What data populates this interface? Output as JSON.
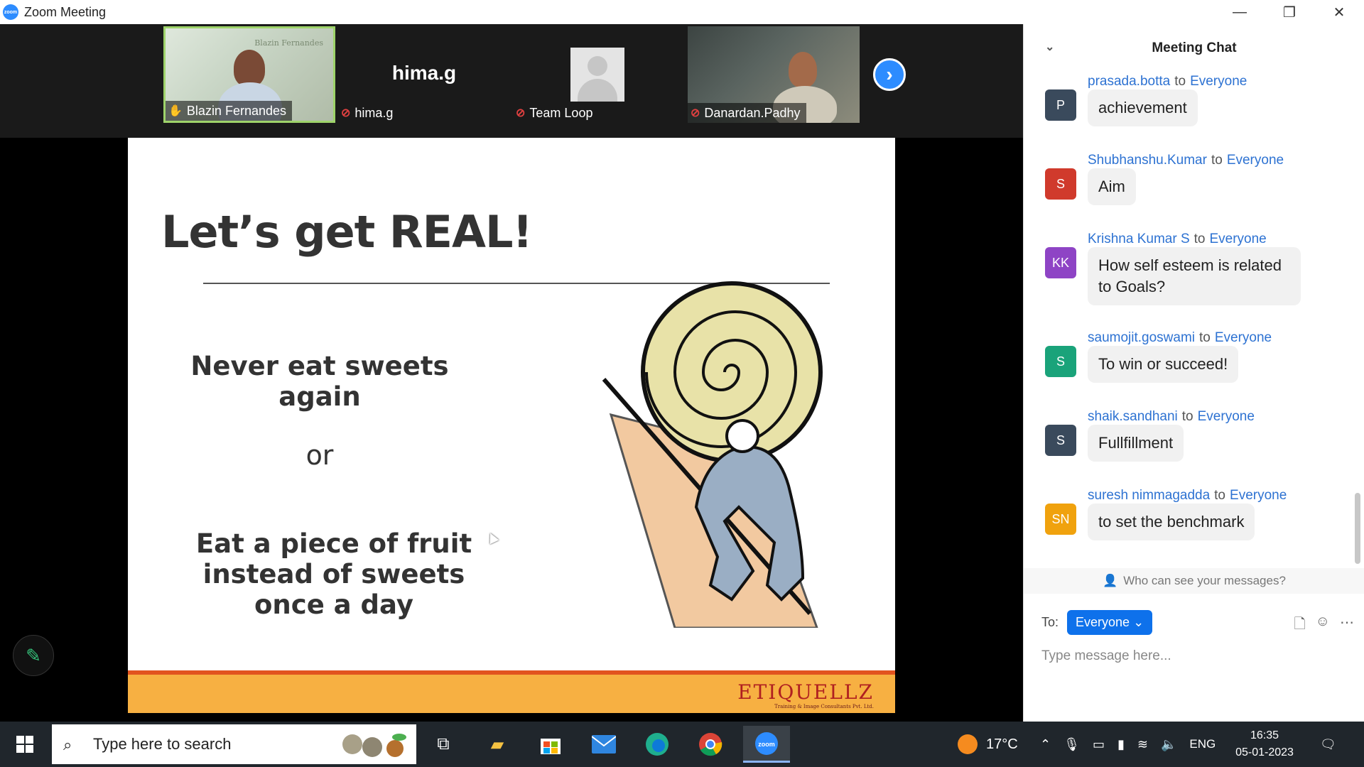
{
  "window": {
    "title": "Zoom Meeting",
    "logo_text": "zoom",
    "minimize": "—",
    "restore": "❐",
    "close": "✕"
  },
  "participants": [
    {
      "name": "Blazin Fernandes",
      "video": true,
      "active": true,
      "muted": false,
      "backdrop_text": "Blazin Fernandes"
    },
    {
      "name": "hima.g",
      "video": false,
      "active": false,
      "muted": true,
      "display_name": "hima.g"
    },
    {
      "name": "Team Loop",
      "video": false,
      "active": false,
      "muted": true
    },
    {
      "name": "Danardan.Padhy",
      "video": true,
      "active": false,
      "muted": true
    }
  ],
  "gallery": {
    "next_label": "›"
  },
  "slide": {
    "title": "Let’s get REAL!",
    "line1": "Never eat sweets again",
    "line2": "or",
    "line3": "Eat a piece of fruit instead of sweets once a day",
    "logo": "ETIQUELLZ",
    "logo_sub": "Training & Image Consultants Pvt. Ltd."
  },
  "annotate": {
    "icon": "pencil-icon",
    "glyph": "✎"
  },
  "chat": {
    "title": "Meeting Chat",
    "collapse": "⌄",
    "to_word": "to",
    "messages": [
      {
        "sender": "prasada.botta",
        "recipient": "Everyone",
        "initials": "P",
        "color": "#3a4a5c",
        "text": "achievement"
      },
      {
        "sender": "Shubhanshu.Kumar",
        "recipient": "Everyone",
        "initials": "S",
        "color": "#d03a2c",
        "text": "Aim"
      },
      {
        "sender": "Krishna Kumar S",
        "recipient": "Everyone",
        "initials": "KK",
        "color": "#8e44c5",
        "text": "How self esteem is related to Goals?"
      },
      {
        "sender": "saumojit.goswami",
        "recipient": "Everyone",
        "initials": "S",
        "color": "#1aa37a",
        "text": "To win or succeed!"
      },
      {
        "sender": "shaik.sandhani",
        "recipient": "Everyone",
        "initials": "S",
        "color": "#3a4a5c",
        "text": "Fullfillment"
      },
      {
        "sender": "suresh nimmagadda",
        "recipient": "Everyone",
        "initials": "SN",
        "color": "#f0a20e",
        "text": "to set the benchmark"
      }
    ],
    "privacy_note": "Who can see your messages?",
    "to_label": "To:",
    "recipient": "Everyone",
    "input_placeholder": "Type message here..."
  },
  "taskbar": {
    "search_placeholder": "Type here to search",
    "weather": "17°C",
    "language": "ENG",
    "time": "16:35",
    "date": "05-01-2023",
    "apps": [
      "task-view",
      "file-explorer",
      "microsoft-store",
      "mail",
      "edge",
      "chrome",
      "zoom"
    ]
  }
}
